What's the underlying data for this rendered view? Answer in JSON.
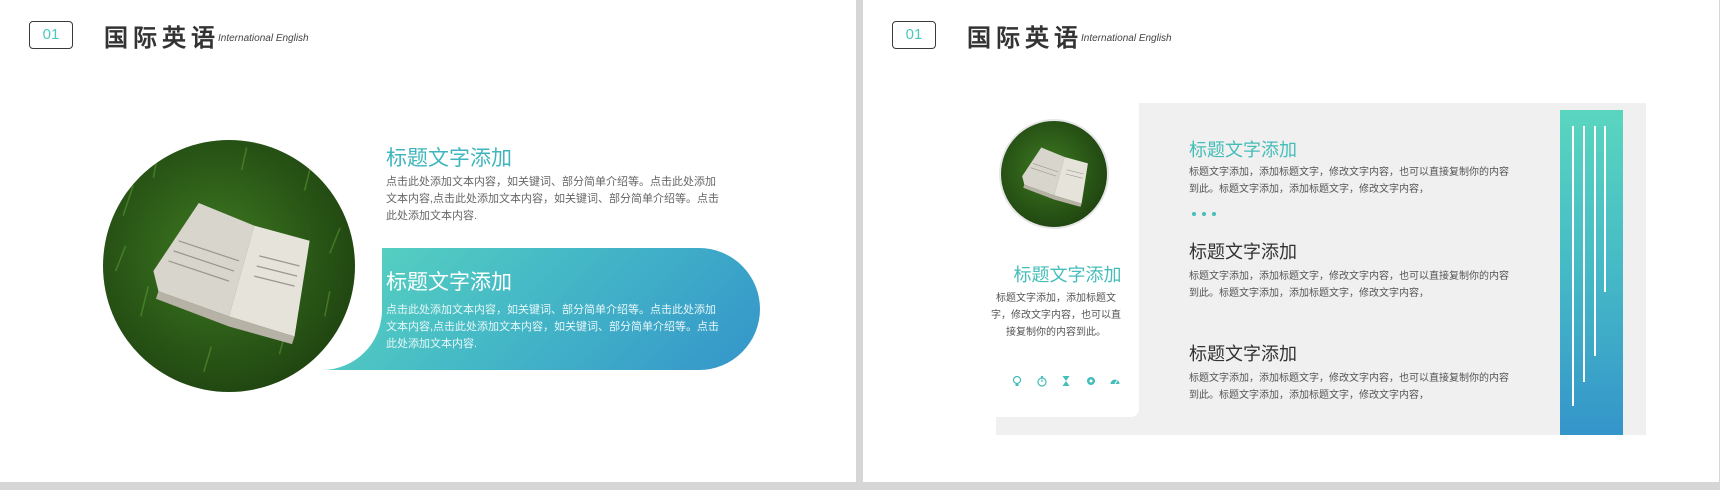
{
  "slides": [
    {
      "number": "01",
      "brand": {
        "title": "国际英语",
        "subtitle": "International English"
      },
      "sections": [
        {
          "title": "标题文字添加",
          "body": "点击此处添加文本内容，如关键词、部分简单介绍等。点击此处添加文本内容,点击此处添加文本内容，如关键词、部分简单介绍等。点击此处添加文本内容."
        },
        {
          "title": "标题文字添加",
          "body": "点击此处添加文本内容，如关键词、部分简单介绍等。点击此处添加文本内容,点击此处添加文本内容，如关键词、部分简单介绍等。点击此处添加文本内容."
        }
      ]
    },
    {
      "number": "01",
      "brand": {
        "title": "国际英语",
        "subtitle": "International English"
      },
      "left_card": {
        "title": "标题文字添加",
        "body": "标题文字添加，添加标题文字，修改文字内容，也可以直接复制你的内容到此。",
        "icons": [
          "lightbulb-icon",
          "stopwatch-icon",
          "hourglass-icon",
          "gear-icon",
          "dashboard-icon"
        ]
      },
      "sections": [
        {
          "title": "标题文字添加",
          "body": "标题文字添加，添加标题文字，修改文字内容，也可以直接复制你的内容到此。标题文字添加，添加标题文字，修改文字内容，"
        },
        {
          "title": "标题文字添加",
          "body": "标题文字添加，添加标题文字，修改文字内容，也可以直接复制你的内容到此。标题文字添加，添加标题文字，修改文字内容，"
        },
        {
          "title": "标题文字添加",
          "body": "标题文字添加，添加标题文字，修改文字内容，也可以直接复制你的内容到此。标题文字添加，添加标题文字，修改文字内容，"
        }
      ]
    }
  ],
  "colors": {
    "accent_teal": "#45bdb9",
    "gradient_start": "#5ad6bf",
    "gradient_end": "#3495ca",
    "panel_gray": "#f0f0f0"
  }
}
